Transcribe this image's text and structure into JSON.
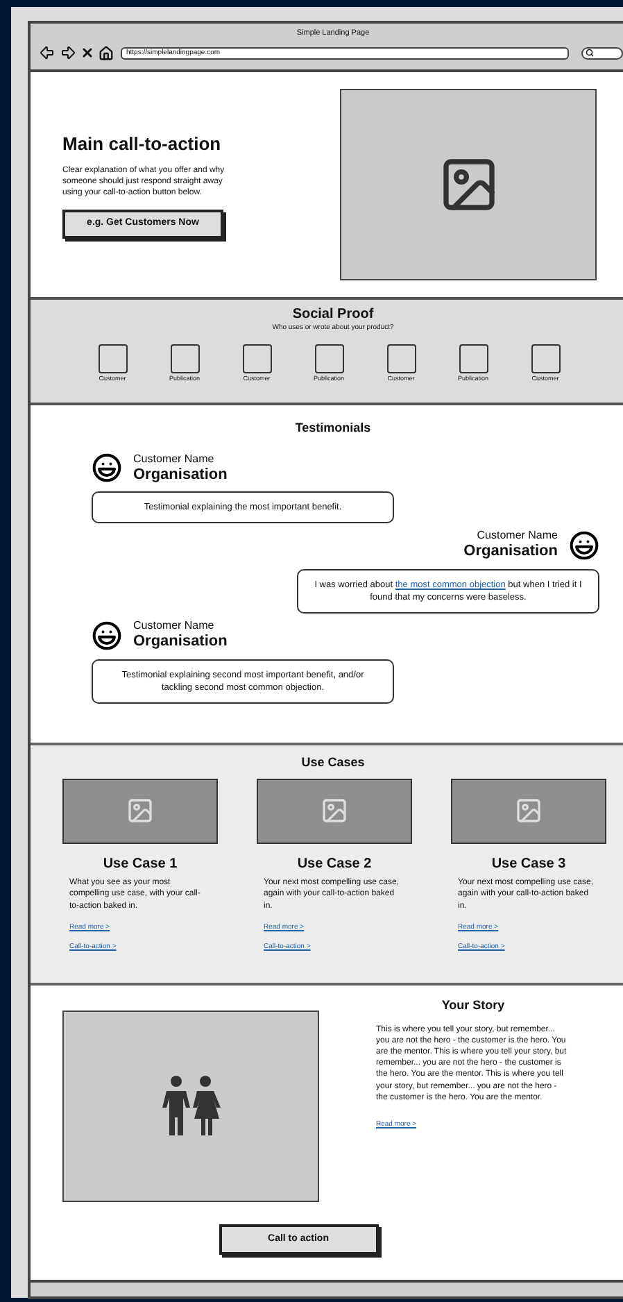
{
  "browser": {
    "title": "Simple Landing Page",
    "url": "https://simplelandingpage.com"
  },
  "hero": {
    "title": "Main call-to-action",
    "description": "Clear explanation of what you offer and why someone should just respond straight away using your call-to-action button below.",
    "button": "e.g. Get Customers Now"
  },
  "social_proof": {
    "title": "Social Proof",
    "subtitle": "Who uses or wrote about your product?",
    "logos": [
      {
        "label": "Customer"
      },
      {
        "label": "Publication"
      },
      {
        "label": "Customer"
      },
      {
        "label": "Publication"
      },
      {
        "label": "Customer"
      },
      {
        "label": "Publication"
      },
      {
        "label": "Customer"
      }
    ]
  },
  "testimonials": {
    "title": "Testimonials",
    "items": [
      {
        "kind": "left",
        "name": "Customer Name",
        "organisation": "Organisation",
        "text_before": "Testimonial explaining the most important benefit."
      },
      {
        "kind": "right",
        "name": "Customer Name",
        "organisation": "Organisation",
        "text_before": "I was worried about",
        "link": "the most common objection",
        "text_after": "but when I tried it I found that my concerns were baseless."
      },
      {
        "kind": "left",
        "name": "Customer Name",
        "organisation": "Organisation",
        "text_before": "Testimonial explaining second most important benefit, and/or tackling second most common objection."
      }
    ]
  },
  "use_cases": {
    "title": "Use Cases",
    "items": [
      {
        "title": "Use Case 1",
        "description": "What you see as your most compelling use case, with your call-to-action baked in.",
        "read_more": "Read more >",
        "cta": "Call-to-action >"
      },
      {
        "title": "Use Case 2",
        "description": "Your next most compelling use case, again with your call-to-action baked in.",
        "read_more": "Read more >",
        "cta": "Call-to-action >"
      },
      {
        "title": "Use Case 3",
        "description": "Your next most compelling use case, again with your call-to-action baked in.",
        "read_more": "Read more >",
        "cta": "Call-to-action >"
      }
    ]
  },
  "story": {
    "title": "Your Story",
    "text": "This is where you tell your story, but remember... you are not the hero - the customer is the hero. You are the mentor. This is where you tell your story, but remember... you are not the hero - the customer is the hero. You are the mentor. This is where you tell your story, but remember... you are not the hero - the customer is the hero. You are the mentor.",
    "read_more": "Read more >",
    "button": "Call to action"
  }
}
